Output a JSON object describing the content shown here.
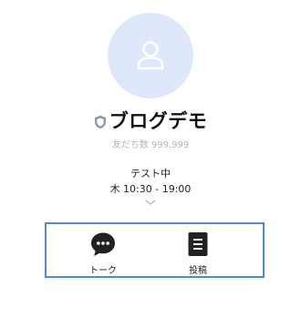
{
  "profile": {
    "name": "ブログデモ",
    "friends_count": "友だち数 999,999",
    "status": "テスト中",
    "hours": "木 10:30 - 19:00",
    "avatar_icon": "user-silhouette-icon",
    "badge_icon": "verified-shield-icon",
    "expand_icon": "chevron-down-icon"
  },
  "actions": {
    "talk": {
      "label": "トーク",
      "icon": "chat-bubble-icon"
    },
    "post": {
      "label": "投稿",
      "icon": "posts-document-icon"
    }
  },
  "colors": {
    "avatar_bg": "#dfe7fb",
    "accent_border": "#4e8dc7",
    "icon_dark": "#222222",
    "muted_text": "#b4b4b4"
  }
}
